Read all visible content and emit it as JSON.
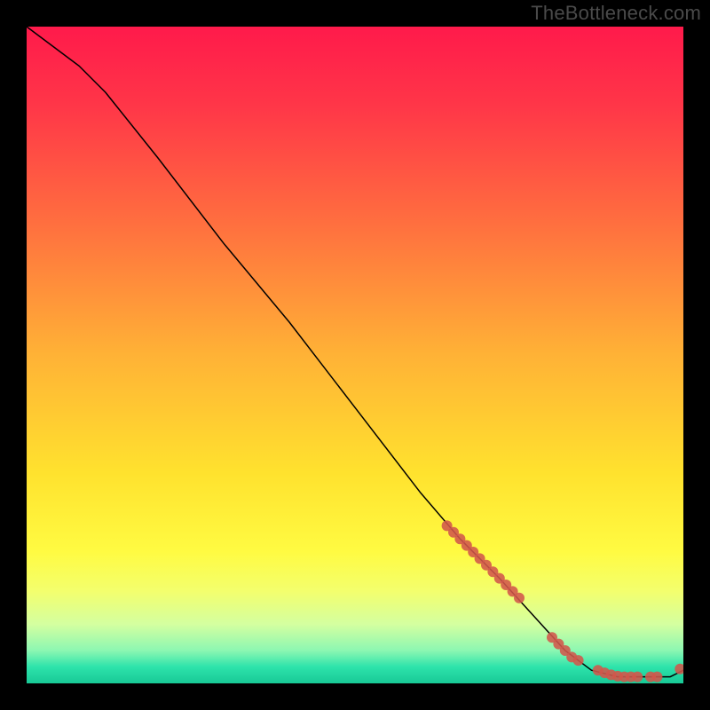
{
  "watermark": "TheBottleneck.com",
  "chart_data": {
    "type": "line",
    "title": "",
    "xlabel": "",
    "ylabel": "",
    "xlim": [
      0,
      100
    ],
    "ylim": [
      0,
      100
    ],
    "grid": false,
    "legend": false,
    "series": [
      {
        "name": "curve",
        "stroke": "#000000",
        "stroke_width": 1.5,
        "x": [
          0,
          8,
          12,
          20,
          30,
          40,
          50,
          60,
          66,
          72,
          82,
          86,
          90,
          94,
          98,
          100
        ],
        "y": [
          100,
          94,
          90,
          80,
          67,
          55,
          42,
          29,
          22,
          16,
          5,
          2,
          1,
          1,
          1,
          2
        ]
      }
    ],
    "highlight_points": {
      "name": "highlight",
      "color": "#d2574b",
      "radius": 6,
      "x": [
        64,
        65,
        66,
        67,
        68,
        69,
        70,
        71,
        72,
        73,
        74,
        75,
        80,
        81,
        82,
        83,
        84,
        87,
        88,
        89,
        90,
        91,
        92,
        93,
        95,
        96,
        99.5
      ],
      "y": [
        24,
        23,
        22,
        21,
        20,
        19,
        18,
        17,
        16,
        15,
        14,
        13,
        7,
        6,
        5,
        4,
        3.5,
        2,
        1.6,
        1.3,
        1.1,
        1,
        1,
        1,
        1,
        1,
        2.2
      ]
    },
    "background_gradient": {
      "stops": [
        {
          "offset": 0.0,
          "color": "#ff1a4b"
        },
        {
          "offset": 0.12,
          "color": "#ff3648"
        },
        {
          "offset": 0.3,
          "color": "#ff6f3f"
        },
        {
          "offset": 0.5,
          "color": "#ffb236"
        },
        {
          "offset": 0.68,
          "color": "#ffe22e"
        },
        {
          "offset": 0.8,
          "color": "#fffb42"
        },
        {
          "offset": 0.86,
          "color": "#f3ff6e"
        },
        {
          "offset": 0.91,
          "color": "#d4ffa0"
        },
        {
          "offset": 0.95,
          "color": "#8cf7b2"
        },
        {
          "offset": 0.975,
          "color": "#2de3ab"
        },
        {
          "offset": 1.0,
          "color": "#18c996"
        }
      ]
    }
  }
}
